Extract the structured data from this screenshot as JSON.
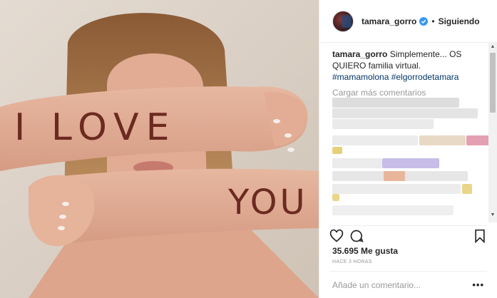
{
  "colors": {
    "link": "#003569",
    "verified": "#3897f0",
    "muted": "#999999",
    "text": "#262626"
  },
  "photo": {
    "arm_top_text": "I LOVE",
    "arm_bottom_text": "YOU"
  },
  "header": {
    "username": "tamara_gorro",
    "separator": "•",
    "follow_status": "Siguiendo",
    "verified_icon": "verified-badge-icon"
  },
  "caption": {
    "username": "tamara_gorro",
    "text": "Simplemente... OS QUIERO familia virtual.",
    "tags": "#mamamolona #elgorrodetamara"
  },
  "comments": {
    "load_more": "Cargar más comentarios"
  },
  "actions": {
    "like_icon": "heart-icon",
    "comment_icon": "comment-icon",
    "save_icon": "bookmark-icon"
  },
  "likes": "35.695 Me gusta",
  "time": "HACE 3 HORAS",
  "add_comment": {
    "placeholder": "Añade un comentario...",
    "more": "•••"
  }
}
